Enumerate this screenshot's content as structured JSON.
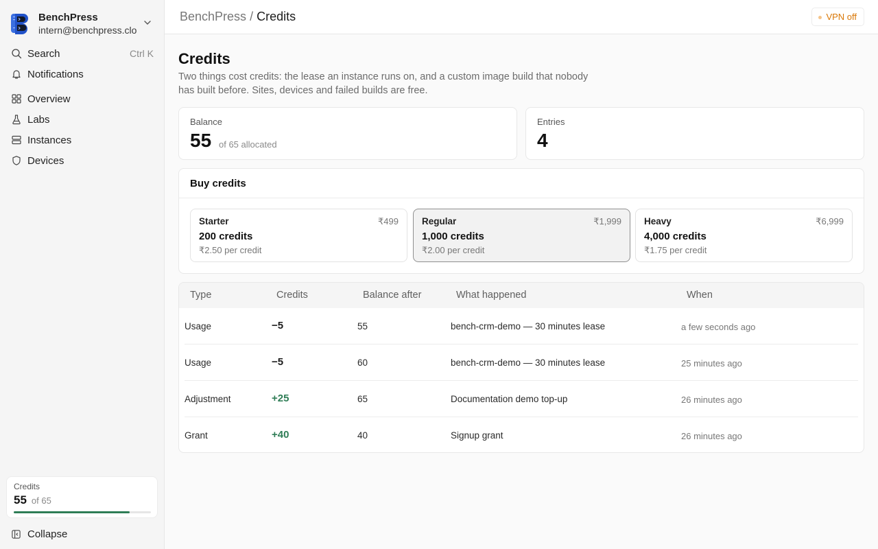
{
  "sidebar": {
    "brand_name": "BenchPress",
    "email": "intern@benchpress.cloud",
    "nav": {
      "search": "Search",
      "search_shortcut": "Ctrl K",
      "notifications": "Notifications",
      "overview": "Overview",
      "labs": "Labs",
      "instances": "Instances",
      "devices": "Devices"
    },
    "credits": {
      "title": "Credits",
      "value": "55",
      "of": "of 65",
      "progress": 0.846
    },
    "collapse": "Collapse"
  },
  "topbar": {
    "crumb_root": "BenchPress",
    "crumb_sep": "/",
    "crumb_current": "Credits",
    "vpn": "VPN off"
  },
  "page": {
    "title": "Credits",
    "description": "Two things cost credits: the lease an instance runs on, and a custom image build that nobody has built before. Sites, devices and failed builds are free."
  },
  "stats": {
    "balance_label": "Balance",
    "balance_value": "55",
    "balance_sub": "of 65 allocated",
    "entries_label": "Entries",
    "entries_value": "4"
  },
  "buy": {
    "title": "Buy credits",
    "plans": [
      {
        "name": "Starter",
        "price": "₹499",
        "credits": "200 credits",
        "per": "₹2.50 per credit"
      },
      {
        "name": "Regular",
        "price": "₹1,999",
        "credits": "1,000 credits",
        "per": "₹2.00 per credit"
      },
      {
        "name": "Heavy",
        "price": "₹6,999",
        "credits": "4,000 credits",
        "per": "₹1.75 per credit"
      }
    ]
  },
  "ledger": {
    "headers": {
      "type": "Type",
      "credits": "Credits",
      "balance": "Balance after",
      "what": "What happened",
      "when": "When"
    },
    "rows": [
      {
        "type": "Usage",
        "credits": "−5",
        "balance": "55",
        "what": "bench-crm-demo — 30 minutes lease",
        "when": "a few seconds ago"
      },
      {
        "type": "Usage",
        "credits": "−5",
        "balance": "60",
        "what": "bench-crm-demo — 30 minutes lease",
        "when": "25 minutes ago"
      },
      {
        "type": "Adjustment",
        "credits": "+25",
        "balance": "65",
        "what": "Documentation demo top-up",
        "when": "26 minutes ago"
      },
      {
        "type": "Grant",
        "credits": "+40",
        "balance": "40",
        "what": "Signup grant",
        "when": "26 minutes ago"
      }
    ]
  },
  "colors": {
    "accent_green": "#2f7d56",
    "vpn_orange": "#d97706",
    "logo_blue": "#2563eb"
  }
}
